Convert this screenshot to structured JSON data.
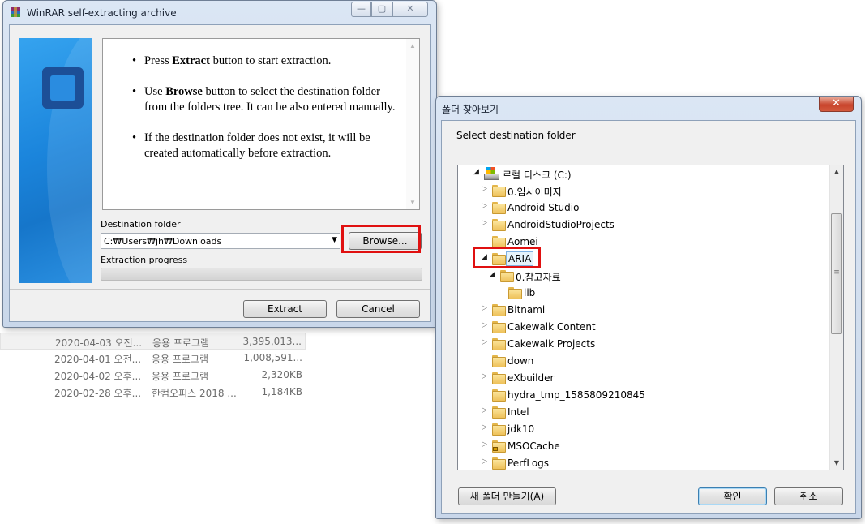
{
  "background_list": {
    "rows": [
      {
        "date": "2020-04-03 오전...",
        "type": "응용 프로그램",
        "size": "3,395,013..."
      },
      {
        "date": "2020-04-01 오전...",
        "type": "응용 프로그램",
        "size": "1,008,591..."
      },
      {
        "date": "2020-04-02 오후...",
        "type": "응용 프로그램",
        "size": "2,320KB"
      },
      {
        "date": "2020-02-28 오후...",
        "type": "한컴오피스 2018 ...",
        "size": "1,184KB"
      }
    ]
  },
  "winrar": {
    "title": "WinRAR self-extracting archive",
    "caption_buttons": {
      "minimize": "—",
      "maximize": "▢",
      "close": "✕"
    },
    "instructions": {
      "item1": {
        "pre": "Press ",
        "bold": "Extract",
        "post": " button to start extraction."
      },
      "item2": {
        "pre": "Use ",
        "bold": "Browse",
        "post": " button to select the destination folder from the folders tree. It can be also entered manually."
      },
      "item3": {
        "text": "If the destination folder does not exist, it will be created automatically before extraction."
      }
    },
    "destination_label": "Destination folder",
    "destination_value": "C:₩Users₩jh₩Downloads",
    "browse_label": "Browse...",
    "progress_label": "Extraction progress",
    "progress_value": 0,
    "extract_label": "Extract",
    "cancel_label": "Cancel"
  },
  "folder_dialog": {
    "title": "폴더 찾아보기",
    "prompt": "Select destination folder",
    "close_glyph": "✕",
    "tree": [
      {
        "label": "로컬 디스크 (C:)",
        "level": 0,
        "expanded": true,
        "icon": "drive-icon"
      },
      {
        "label": "0.임시이미지",
        "level": 1,
        "expander": true,
        "icon": "folder-icon"
      },
      {
        "label": "Android Studio",
        "level": 1,
        "expander": true,
        "icon": "folder-icon"
      },
      {
        "label": "AndroidStudioProjects",
        "level": 1,
        "expander": true,
        "icon": "folder-icon"
      },
      {
        "label": "Aomei",
        "level": 1,
        "expander": false,
        "icon": "folder-icon"
      },
      {
        "label": "ARIA",
        "level": 1,
        "expanded": true,
        "selected": true,
        "icon": "folder-icon"
      },
      {
        "label": "0.참고자료",
        "level": 2,
        "expanded": true,
        "icon": "folder-icon"
      },
      {
        "label": "lib",
        "level": 3,
        "expander": false,
        "icon": "folder-icon"
      },
      {
        "label": "Bitnami",
        "level": 1,
        "expander": true,
        "icon": "folder-icon"
      },
      {
        "label": "Cakewalk Content",
        "level": 1,
        "expander": true,
        "icon": "folder-icon"
      },
      {
        "label": "Cakewalk Projects",
        "level": 1,
        "expander": true,
        "icon": "folder-icon"
      },
      {
        "label": "down",
        "level": 1,
        "expander": false,
        "icon": "folder-icon"
      },
      {
        "label": "eXbuilder",
        "level": 1,
        "expander": true,
        "icon": "folder-icon"
      },
      {
        "label": "hydra_tmp_1585809210845",
        "level": 1,
        "expander": false,
        "icon": "folder-icon"
      },
      {
        "label": "Intel",
        "level": 1,
        "expander": true,
        "icon": "folder-icon"
      },
      {
        "label": "jdk10",
        "level": 1,
        "expander": true,
        "icon": "folder-icon"
      },
      {
        "label": "MSOCache",
        "level": 1,
        "expander": true,
        "icon": "locked-folder-icon"
      },
      {
        "label": "PerfLogs",
        "level": 1,
        "expander": true,
        "icon": "folder-icon"
      }
    ],
    "scroll_up": "▲",
    "scroll_down": "▼",
    "scroll_grip": "≡",
    "new_folder_label": "새 폴더 만들기(A)",
    "ok_label": "확인",
    "cancel_label": "취소"
  },
  "colors": {
    "highlight": "#e01010",
    "winrar_side": "#1b85dc",
    "selection": "#e5f3fb"
  }
}
